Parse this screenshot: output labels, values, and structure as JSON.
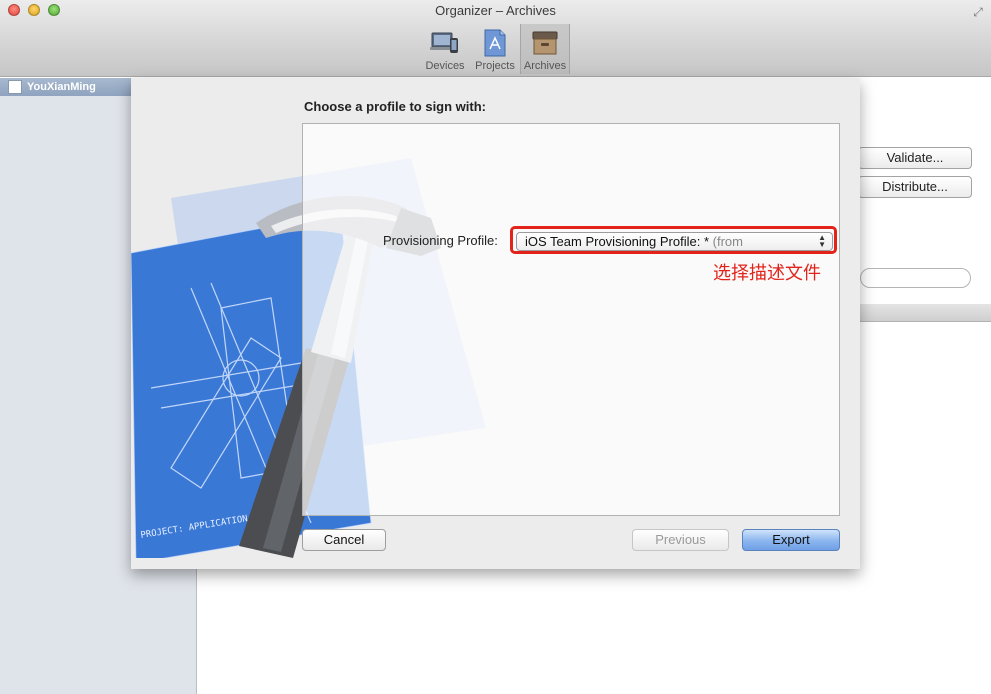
{
  "window": {
    "title": "Organizer – Archives"
  },
  "toolbar": {
    "items": [
      {
        "label": "Devices",
        "icon": "devices-icon",
        "active": false
      },
      {
        "label": "Projects",
        "icon": "projects-icon",
        "active": false
      },
      {
        "label": "Archives",
        "icon": "archives-icon",
        "active": true
      }
    ]
  },
  "sidebar": {
    "items": [
      {
        "label": "YouXianMing",
        "selected": true
      }
    ]
  },
  "background": {
    "validate_label": "Validate...",
    "distribute_label": "Distribute..."
  },
  "sheet": {
    "title": "Choose a profile to sign with:",
    "provisioning_label": "Provisioning Profile:",
    "provisioning_value": "iOS Team Provisioning Profile: *",
    "provisioning_suffix": "(from",
    "annotation": "选择描述文件",
    "cancel_label": "Cancel",
    "previous_label": "Previous",
    "export_label": "Export",
    "hero_text": "PROJECT: APPLICATION.APP"
  },
  "colors": {
    "annotation": "#e2231a",
    "export_button": "#8ab5ee",
    "sidebar_selection": "#98abc5"
  }
}
